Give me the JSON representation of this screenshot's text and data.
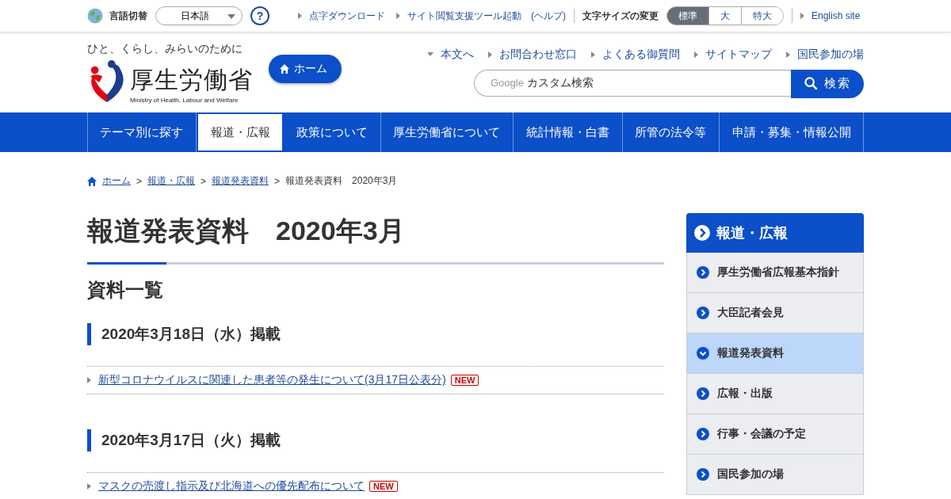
{
  "top_bar": {
    "language_label": "言語切替",
    "language_select": "日本語",
    "help": "?",
    "links": [
      {
        "label": "点字ダウンロード"
      },
      {
        "label": "サイト閲覧支援ツール起動　(ヘルプ)"
      }
    ],
    "font_size_label": "文字サイズの変更",
    "font_sizes": [
      {
        "label": "標準",
        "selected": true
      },
      {
        "label": "大",
        "selected": false
      },
      {
        "label": "特大",
        "selected": false
      }
    ],
    "english_link": "English site"
  },
  "header": {
    "tagline": "ひと、くらし、みらいのために",
    "logo_text": "厚生労働省",
    "logo_subtext": "Ministry of Health, Labour and Welfare",
    "home_button": "ホーム",
    "utility_links": [
      {
        "label": "本文へ",
        "kind": "down"
      },
      {
        "label": "お問合わせ窓口",
        "kind": "right"
      },
      {
        "label": "よくある御質問",
        "kind": "right"
      },
      {
        "label": "サイトマップ",
        "kind": "right"
      },
      {
        "label": "国民参加の場",
        "kind": "right"
      }
    ],
    "search": {
      "brand": "Google",
      "placeholder": "カスタム検索",
      "button": "検索"
    }
  },
  "nav": [
    {
      "label": "テーマ別に探す",
      "selected": false
    },
    {
      "label": "報道・広報",
      "selected": true
    },
    {
      "label": "政策について",
      "selected": false
    },
    {
      "label": "厚生労働省について",
      "selected": false
    },
    {
      "label": "統計情報・白書",
      "selected": false
    },
    {
      "label": "所管の法令等",
      "selected": false
    },
    {
      "label": "申請・募集・情報公開",
      "selected": false
    }
  ],
  "breadcrumb": {
    "links": [
      "ホーム",
      "報道・広報",
      "報道発表資料"
    ],
    "current": "報道発表資料　2020年3月",
    "separator": ">"
  },
  "page_title": "報道発表資料　2020年3月",
  "section_title": "資料一覧",
  "groups": [
    {
      "date": "2020年3月18日（水）掲載",
      "items": [
        {
          "title": "新型コロナウイルスに関連した患者等の発生について(3月17日公表分)",
          "badge": "NEW"
        }
      ]
    },
    {
      "date": "2020年3月17日（火）掲載",
      "items": [
        {
          "title": "マスクの売渡し指示及び北海道への優先配布について",
          "badge": "NEW"
        }
      ]
    }
  ],
  "sidebar": {
    "title": "報道・広報",
    "items": [
      {
        "label": "厚生労働省広報基本指針",
        "selected": false
      },
      {
        "label": "大臣記者会見",
        "selected": false
      },
      {
        "label": "報道発表資料",
        "selected": true
      },
      {
        "label": "広報・出版",
        "selected": false
      },
      {
        "label": "行事・会議の予定",
        "selected": false
      },
      {
        "label": "国民参加の場",
        "selected": false
      }
    ]
  }
}
